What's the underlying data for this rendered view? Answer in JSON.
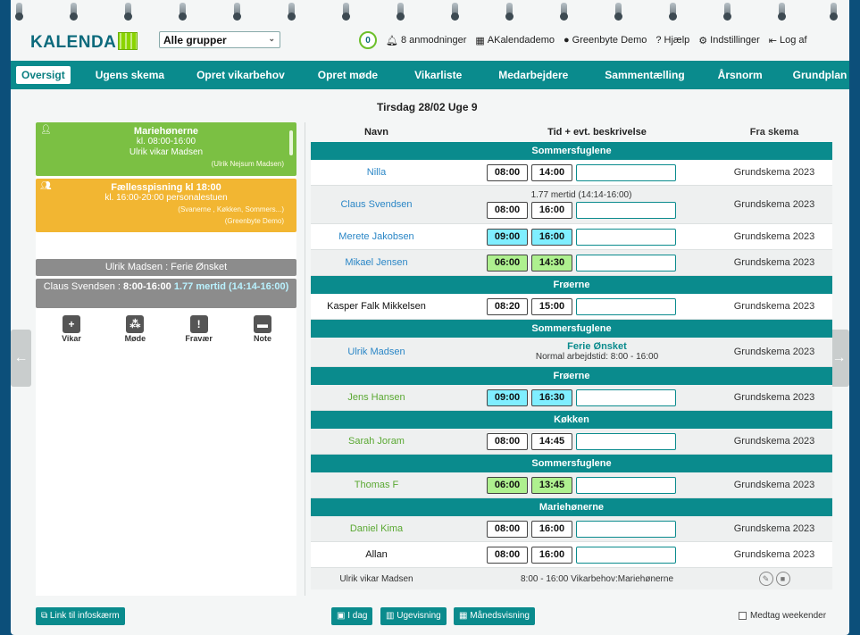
{
  "header": {
    "logo_text": "KALENDA",
    "group_select_value": "Alle grupper",
    "notifications_count": "0",
    "links": {
      "requests": "8 anmodninger",
      "org": "AKalendademo",
      "user": "Greenbyte Demo",
      "help": "Hjælp",
      "settings": "Indstillinger",
      "logout": "Log af"
    }
  },
  "nav": {
    "items": [
      "Oversigt",
      "Ugens skema",
      "Opret vikarbehov",
      "Opret møde",
      "Vikarliste",
      "Medarbejdere",
      "Sammentælling",
      "Årsnorm",
      "Grundplan"
    ],
    "active": "Oversigt"
  },
  "date_header": "Tirsdag 28/02 Uge 9",
  "left": {
    "card1": {
      "title": "Mariehønerne",
      "time": "kl. 08:00-16:00",
      "person": "Ulrik vikar Madsen",
      "sub": "(Ulrik Nejsum Madsen)"
    },
    "card2": {
      "title": "Fællesspisning kl 18:00",
      "time": "kl. 16:00-20:00 personalestuen",
      "sub1": "(Svanerne , Køkken, Sommers...)",
      "sub2": "(Greenbyte Demo)"
    },
    "absence1": "Ulrik Madsen : Ferie Ønsket",
    "absence2_prefix": "Claus Svendsen : ",
    "absence2_time": "8:00-16:00",
    "absence2_extra": "1.77 mertid (14:14-16:00)",
    "actions": [
      "Vikar",
      "Møde",
      "Fravær",
      "Note"
    ]
  },
  "table": {
    "headers": {
      "name": "Navn",
      "time": "Tid + evt. beskrivelse",
      "source": "Fra skema"
    },
    "groups": {
      "g1": "Sommersfuglene",
      "g2": "Frøerne",
      "g3": "Sommersfuglene",
      "g4": "Frøerne",
      "g5": "Køkken",
      "g6": "Sommersfuglene",
      "g7": "Mariehønerne"
    },
    "rows": {
      "nilla": {
        "name": "Nilla",
        "start": "08:00",
        "end": "14:00",
        "source": "Grundskema 2023"
      },
      "claus": {
        "name": "Claus Svendsen",
        "note": "1.77 mertid (14:14-16:00)",
        "start": "08:00",
        "end": "16:00",
        "source": "Grundskema 2023"
      },
      "merete": {
        "name": "Merete Jakobsen",
        "start": "09:00",
        "end": "16:00",
        "source": "Grundskema 2023"
      },
      "mikael": {
        "name": "Mikael Jensen",
        "start": "06:00",
        "end": "14:30",
        "source": "Grundskema 2023"
      },
      "kasper": {
        "name": "Kasper Falk Mikkelsen",
        "start": "08:20",
        "end": "15:00",
        "source": "Grundskema 2023"
      },
      "ulrik": {
        "name": "Ulrik Madsen",
        "status": "Ferie Ønsket",
        "normal": "Normal arbejdstid: 8:00 - 16:00",
        "source": "Grundskema 2023"
      },
      "jens": {
        "name": "Jens Hansen",
        "start": "09:00",
        "end": "16:30",
        "source": "Grundskema 2023"
      },
      "sarah": {
        "name": "Sarah Joram",
        "start": "08:00",
        "end": "14:45",
        "source": "Grundskema 2023"
      },
      "thomas": {
        "name": "Thomas F",
        "start": "06:00",
        "end": "13:45",
        "source": "Grundskema 2023"
      },
      "daniel": {
        "name": "Daniel Kima",
        "start": "08:00",
        "end": "16:00",
        "source": "Grundskema 2023"
      },
      "allan": {
        "name": "Allan",
        "start": "08:00",
        "end": "16:00",
        "source": "Grundskema 2023"
      }
    },
    "vikar": {
      "name": "Ulrik vikar Madsen",
      "text": "8:00 - 16:00  Vikarbehov:Mariehønerne"
    }
  },
  "bottom": {
    "infoscreen": "Link til infoskærm",
    "today": "I dag",
    "week": "Ugevisning",
    "month": "Månedsvisning",
    "weekend": "Medtag weekender"
  },
  "colors": {
    "teal": "#0a8b8d",
    "green_card": "#7bc043",
    "yellow_card": "#f2b632",
    "cyan_time": "#7feeff",
    "green_time": "#aef08f"
  }
}
